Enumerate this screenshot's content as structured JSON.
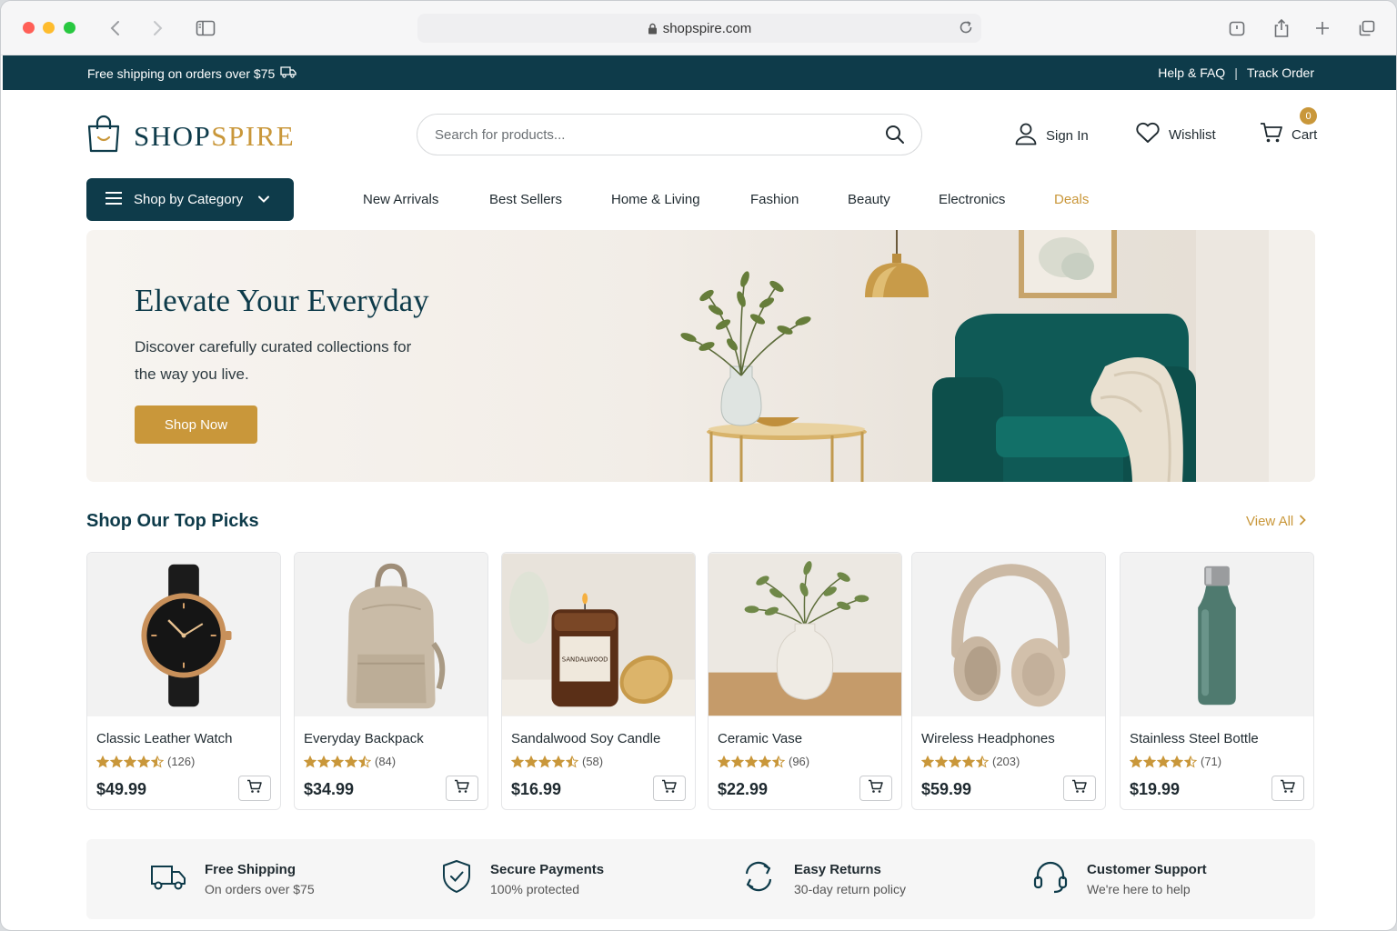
{
  "browser": {
    "url": "shopspire.com"
  },
  "promo": {
    "shipping_text": "Free shipping on orders over $75",
    "help_link": "Help & FAQ",
    "separator": "|",
    "track_link": "Track Order"
  },
  "header": {
    "logo_part1": "SHOP",
    "logo_part2": "SPIRE",
    "search_placeholder": "Search for products...",
    "sign_in": "Sign In",
    "wishlist": "Wishlist",
    "cart": "Cart",
    "cart_count": "0"
  },
  "nav": {
    "category_button": "Shop by Category",
    "items": [
      "New Arrivals",
      "Best Sellers",
      "Home & Living",
      "Fashion",
      "Beauty",
      "Electronics",
      "Deals"
    ]
  },
  "hero": {
    "title": "Elevate Your Everyday",
    "subtitle": "Discover carefully curated collections for the way you live.",
    "cta": "Shop Now"
  },
  "top_picks": {
    "title": "Shop Our Top Picks",
    "view_all": "View All",
    "products": [
      {
        "name": "Classic Leather Watch",
        "rating": 4.5,
        "reviews": "(126)",
        "price": "$49.99"
      },
      {
        "name": "Everyday Backpack",
        "rating": 4.5,
        "reviews": "(84)",
        "price": "$34.99"
      },
      {
        "name": "Sandalwood Soy Candle",
        "rating": 4.5,
        "reviews": "(58)",
        "price": "$16.99",
        "label_text": "SANDALWOOD"
      },
      {
        "name": "Ceramic Vase",
        "rating": 4.5,
        "reviews": "(96)",
        "price": "$22.99"
      },
      {
        "name": "Wireless Headphones",
        "rating": 4.5,
        "reviews": "(203)",
        "price": "$59.99"
      },
      {
        "name": "Stainless Steel Bottle",
        "rating": 4.5,
        "reviews": "(71)",
        "price": "$19.99"
      }
    ]
  },
  "features": [
    {
      "title": "Free Shipping",
      "subtitle": "On orders over $75",
      "icon": "truck-icon"
    },
    {
      "title": "Secure Payments",
      "subtitle": "100% protected",
      "icon": "shield-icon"
    },
    {
      "title": "Easy Returns",
      "subtitle": "30-day return policy",
      "icon": "returns-icon"
    },
    {
      "title": "Customer Support",
      "subtitle": "We're here to help",
      "icon": "headset-icon"
    }
  ],
  "colors": {
    "brand_dark": "#0e3b4a",
    "accent_gold": "#c9973a",
    "star": "#c9973a"
  }
}
